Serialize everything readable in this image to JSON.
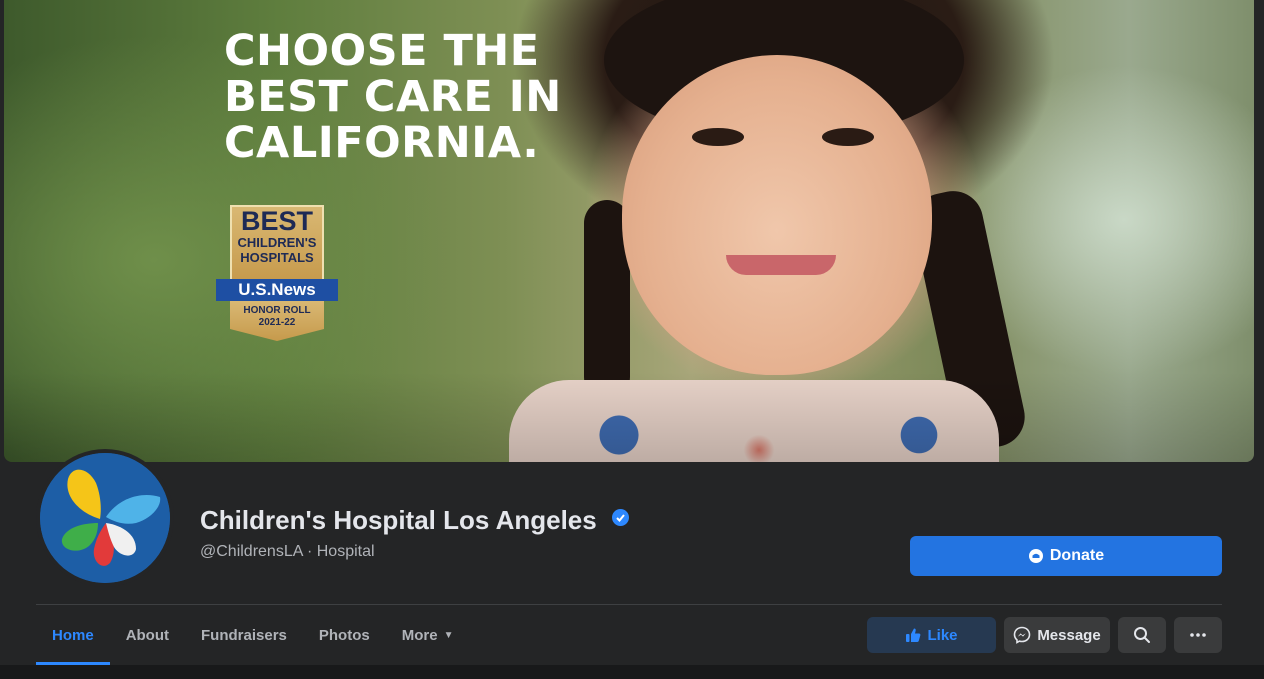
{
  "cover": {
    "headline_lines": [
      "CHOOSE THE",
      "BEST CARE IN",
      "CALIFORNIA."
    ],
    "badge": {
      "best": "BEST",
      "line1": "CHILDREN'S",
      "line2": "HOSPITALS",
      "brand": "U.S.News",
      "honor": "HONOR ROLL",
      "years": "2021-22"
    }
  },
  "profile": {
    "name": "Children's Hospital Los Angeles",
    "handle_category": "@ChildrensLA · Hospital",
    "verified": true
  },
  "actions": {
    "donate": "Donate",
    "like": "Like",
    "message": "Message"
  },
  "tabs": [
    {
      "label": "Home",
      "active": true
    },
    {
      "label": "About",
      "active": false
    },
    {
      "label": "Fundraisers",
      "active": false
    },
    {
      "label": "Photos",
      "active": false
    },
    {
      "label": "More",
      "active": false
    }
  ],
  "colors": {
    "accent": "#2d88ff",
    "donate_bg": "#2374e1",
    "like_bg": "#263951",
    "surface": "#242526",
    "button_bg": "#3a3b3c"
  },
  "icons": {
    "verified": "verified-badge-icon",
    "donate": "donate-icon",
    "like": "thumbs-up-icon",
    "message": "messenger-icon",
    "search": "search-icon",
    "more": "more-dots-icon",
    "more_tab": "caret-down-icon"
  }
}
